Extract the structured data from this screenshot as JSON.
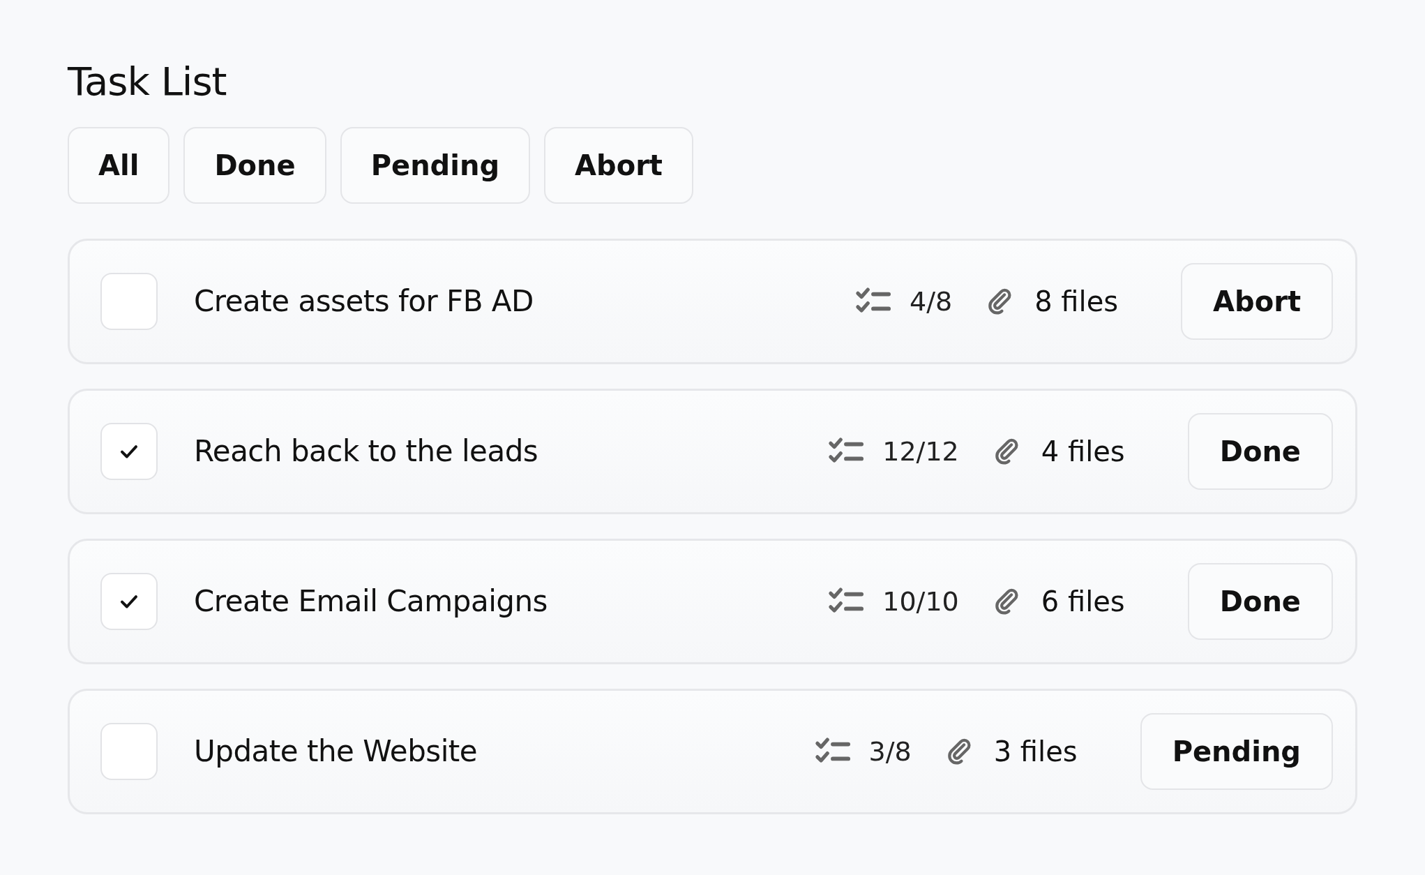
{
  "title": "Task List",
  "filters": [
    {
      "label": "All"
    },
    {
      "label": "Done"
    },
    {
      "label": "Pending"
    },
    {
      "label": "Abort"
    }
  ],
  "tasks": [
    {
      "checked": false,
      "name": "Create assets for FB AD",
      "subtasks": "4/8",
      "files": "8 files",
      "status": "Abort"
    },
    {
      "checked": true,
      "name": "Reach back to the leads",
      "subtasks": "12/12",
      "files": "4 files",
      "status": "Done"
    },
    {
      "checked": true,
      "name": "Create Email Campaigns",
      "subtasks": "10/10",
      "files": "6 files",
      "status": "Done"
    },
    {
      "checked": false,
      "name": "Update the Website",
      "subtasks": "3/8",
      "files": "3 files",
      "status": "Pending"
    }
  ]
}
